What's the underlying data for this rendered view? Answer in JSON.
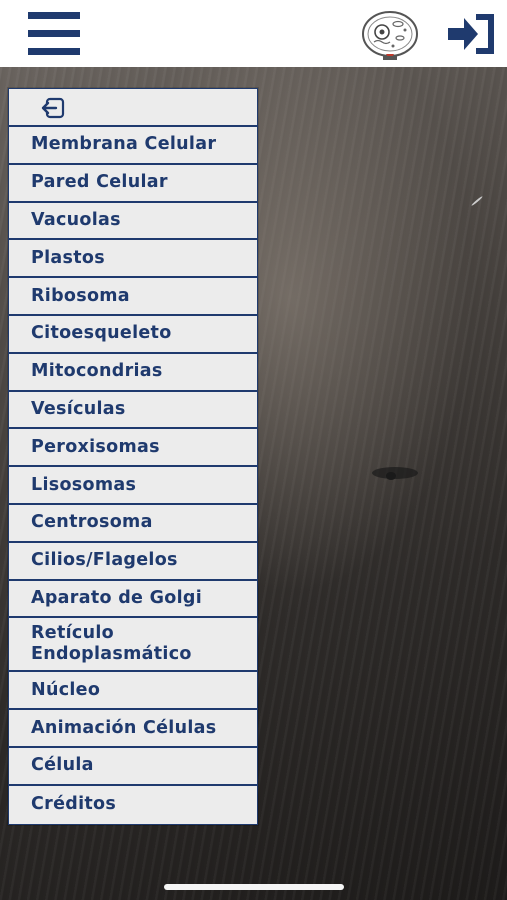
{
  "header": {
    "menu_icon": "hamburger-icon",
    "cell_icon": "cell-diagram-icon",
    "exit_icon": "exit-icon"
  },
  "menu": {
    "back_icon": "back-arrow-icon",
    "items": [
      "Membrana Celular",
      "Pared Celular",
      "Vacuolas",
      "Plastos",
      "Ribosoma",
      "Citoesqueleto",
      "Mitocondrias",
      "Vesículas",
      "Peroxisomas",
      "Lisosomas",
      "Centrosoma",
      "Cilios/Flagelos",
      "Aparato de Golgi",
      "Retículo Endoplasmático",
      "Núcleo",
      "Animación Células",
      "Célula",
      "Créditos"
    ]
  },
  "colors": {
    "accent": "#1f3a6e",
    "menu_bg": "#ececec",
    "header_bg": "#ffffff"
  }
}
